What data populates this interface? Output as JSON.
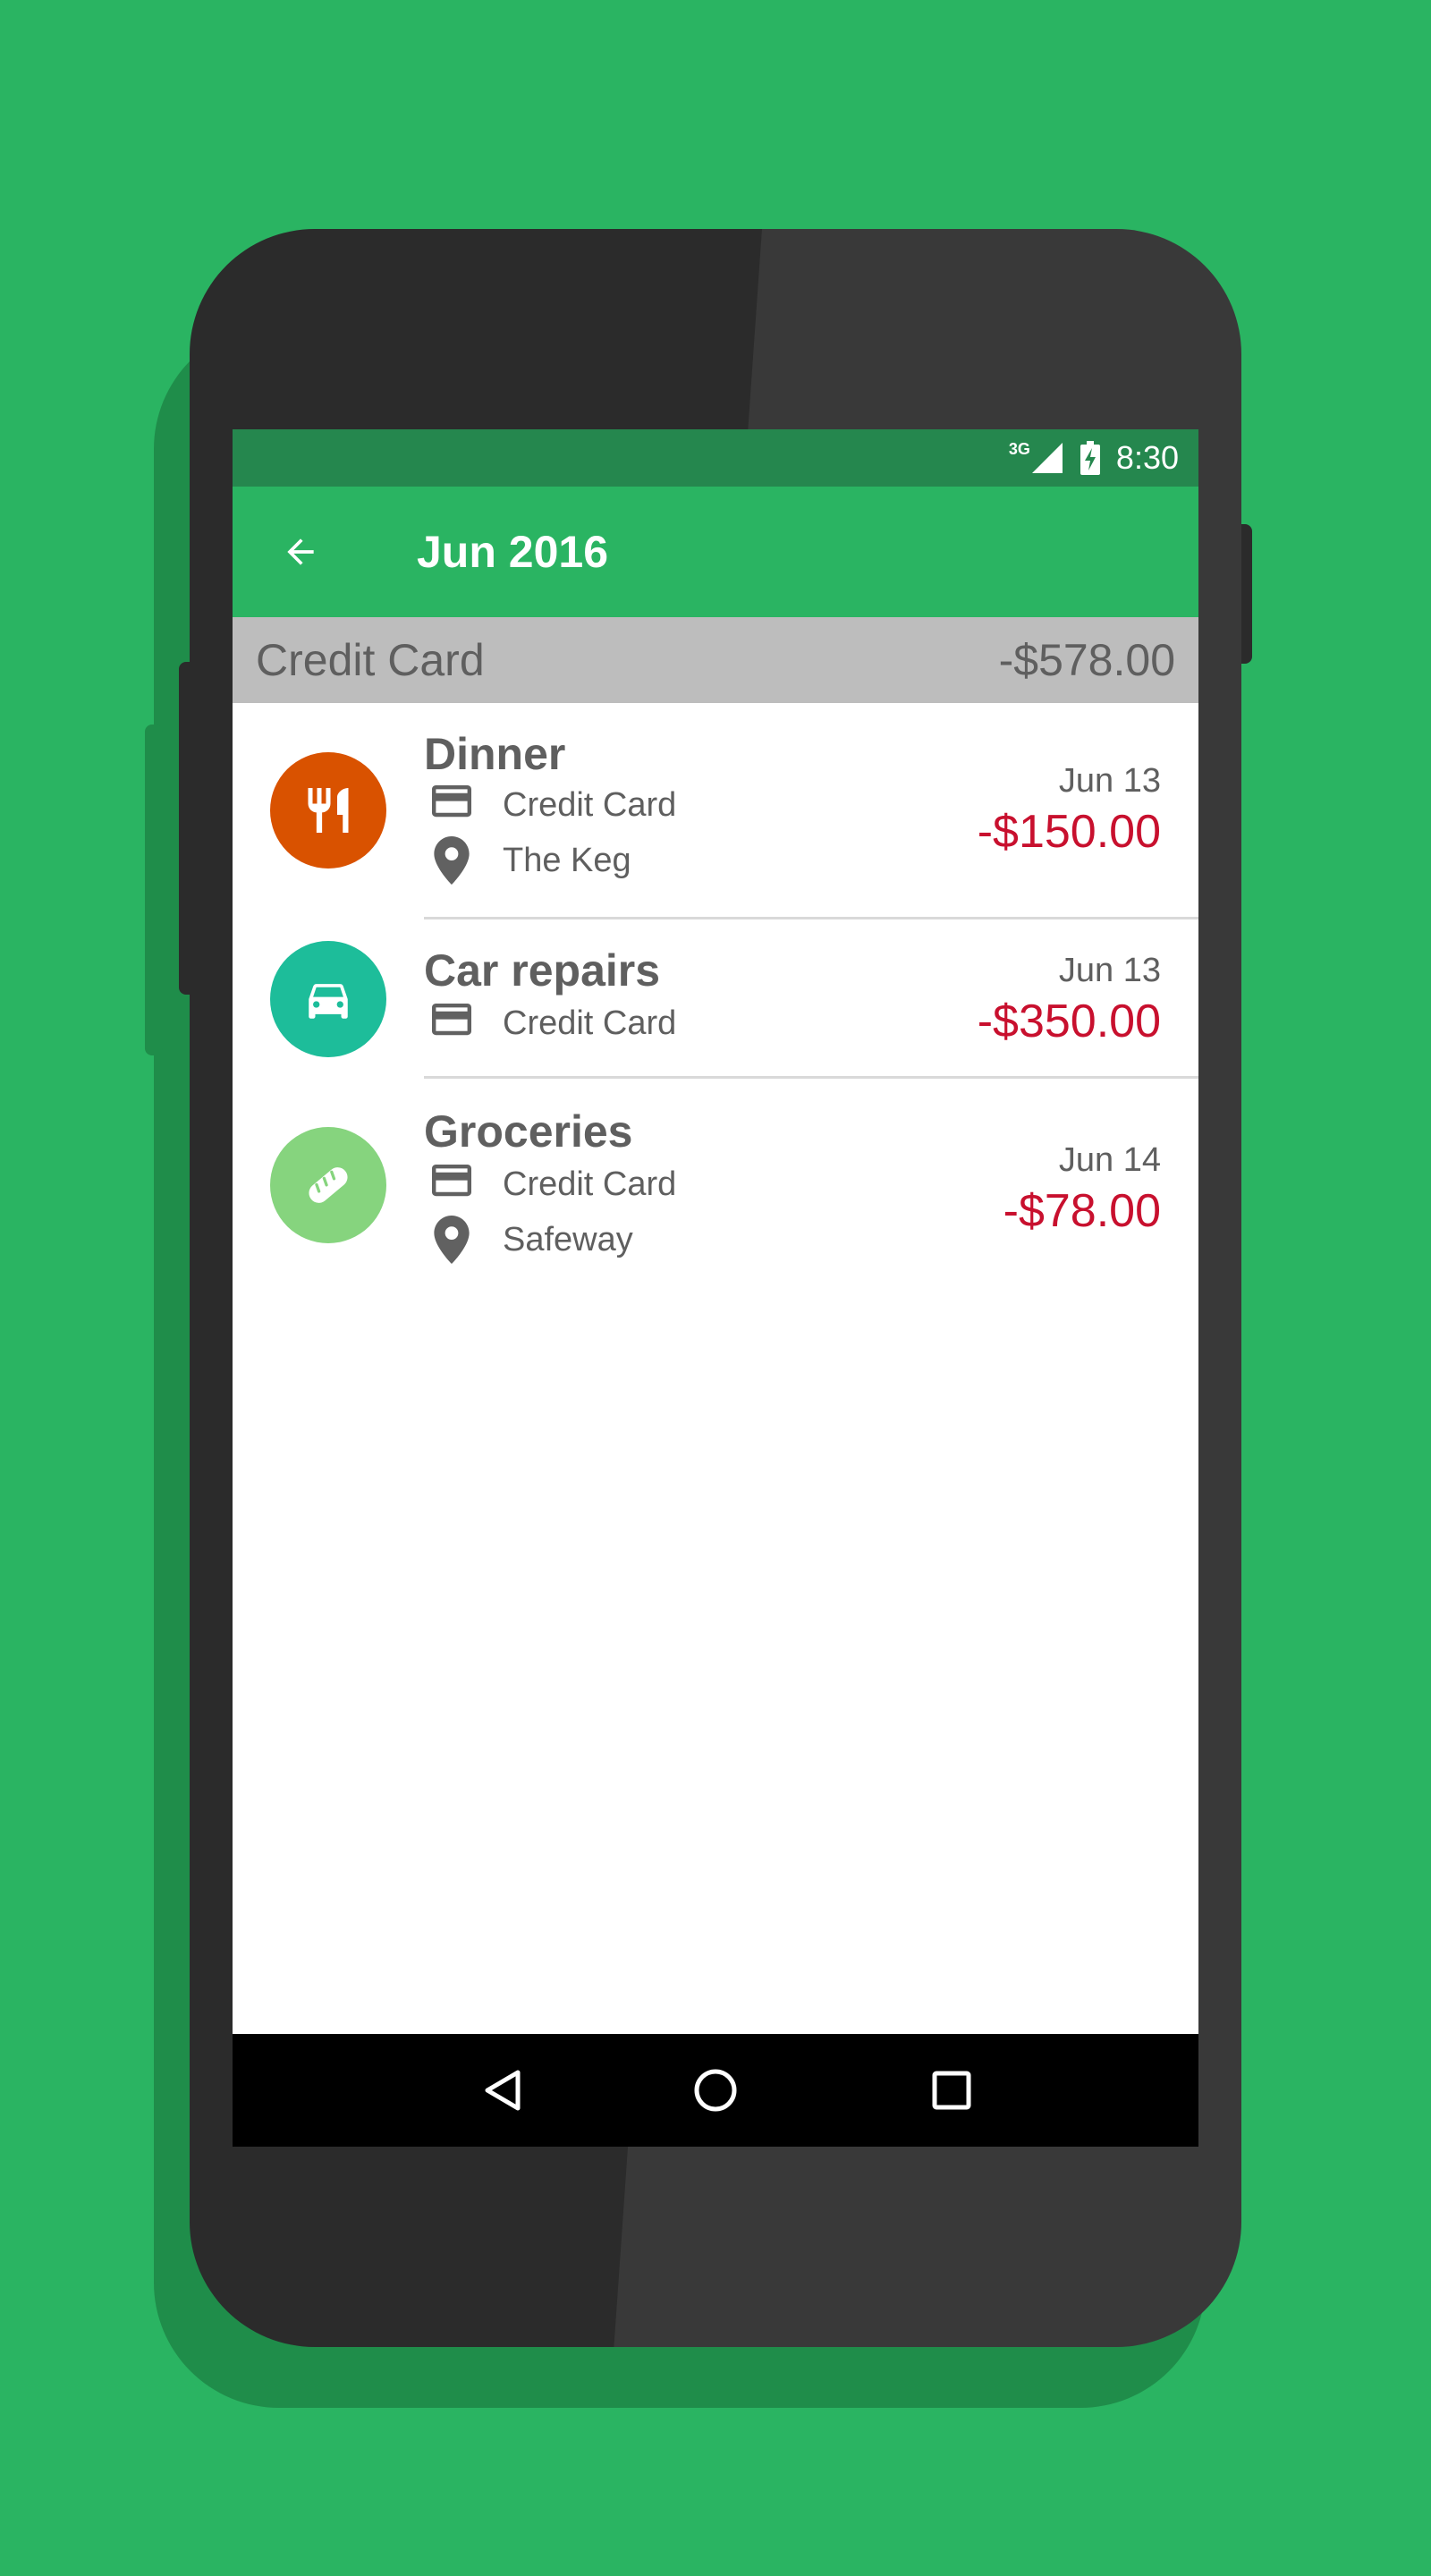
{
  "status_bar": {
    "network": "3G",
    "time": "8:30"
  },
  "app_bar": {
    "title": "Jun 2016",
    "back_icon": "arrow-back-icon"
  },
  "account_header": {
    "name": "Credit Card",
    "total": "-$578.00"
  },
  "transactions": [
    {
      "title": "Dinner",
      "icon": "restaurant-icon",
      "color": "#d95200",
      "payment": "Credit Card",
      "location": "The Keg",
      "date": "Jun 13",
      "amount": "-$150.00"
    },
    {
      "title": "Car repairs",
      "icon": "car-icon",
      "color": "#1dbd9a",
      "payment": "Credit Card",
      "date": "Jun 13",
      "amount": "-$350.00"
    },
    {
      "title": "Groceries",
      "icon": "bread-icon",
      "color": "#86d47e",
      "payment": "Credit Card",
      "location": "Safeway",
      "date": "Jun 14",
      "amount": "-$78.00"
    }
  ],
  "colors": {
    "background": "#2ab462",
    "app_bar": "#2ab462",
    "status_bar": "#25874e",
    "header": "#bdbdbd",
    "amount": "#c8102e"
  }
}
